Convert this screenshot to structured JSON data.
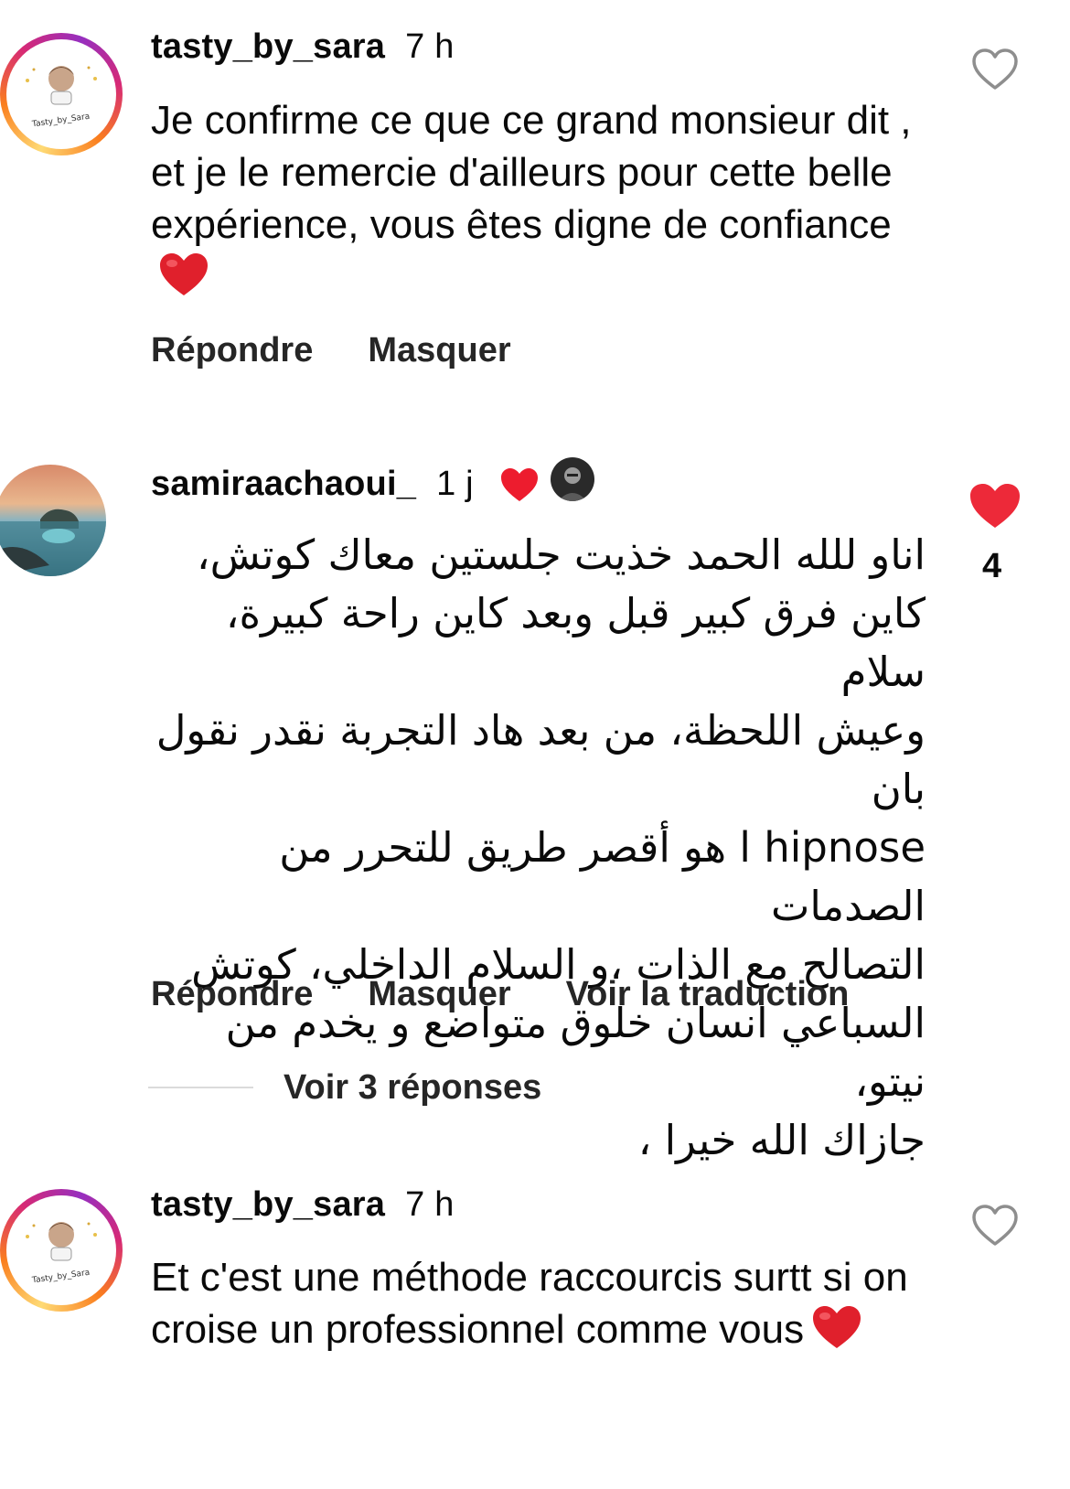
{
  "comments": [
    {
      "username": "tasty_by_sara",
      "time": "7 h",
      "text": "Je confirme ce que ce grand monsieur dit , et je le remercie d'ailleurs pour cette belle expérience, vous êtes digne de confiance",
      "emoji": "❤️",
      "actions": [
        "Répondre",
        "Masquer"
      ],
      "liked": false,
      "avatar_text": "Tasty_by_Sara"
    },
    {
      "username": "samiraachaoui_",
      "time": "1 j",
      "text_lines": [
        "اناو للله الحمد  خذيت جلستين معاك كوتش،",
        "كاين فرق كبير قبل وبعد كاين راحة كبيرة، سلام",
        "وعيش اللحظة، من بعد هاد التجربة نقدر نقول بان",
        "l hipnose هو أقصر طريق للتحرر من الصدمات",
        "التصالح مع الذات ،و السلام الداخلي، كوتش",
        "السباعي انسان خلوق متواضع و يخدم من نيتو،",
        "جازاك الله خيرا ،"
      ],
      "actions": [
        "Répondre",
        "Masquer",
        "Voir la traduction"
      ],
      "liked": true,
      "like_count": "4",
      "view_replies": "Voir 3 réponses"
    },
    {
      "username": "tasty_by_sara",
      "time": "7 h",
      "text": "Et c'est une méthode raccourcis surtt si on croise un professionnel comme vous",
      "emoji": "❤️",
      "liked": false,
      "avatar_text": "Tasty_by_Sara"
    }
  ],
  "colors": {
    "heart_red": "#ed4956",
    "text": "#0a0a0a",
    "secondary": "#262626"
  }
}
